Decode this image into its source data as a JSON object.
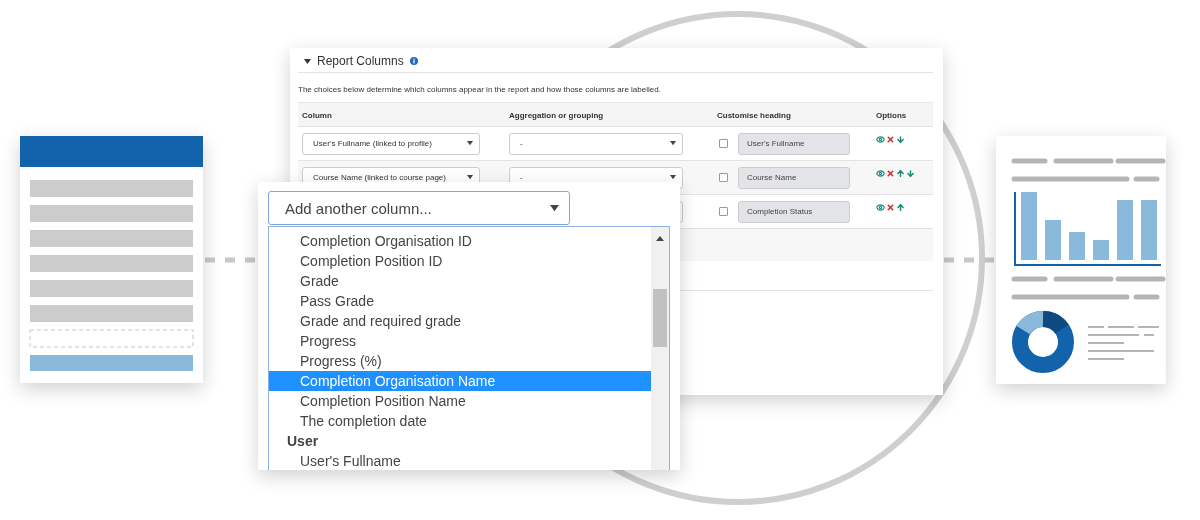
{
  "report": {
    "title": "Report Columns",
    "description": "The choices below determine which columns appear in the report and how those columns are labelled.",
    "columns": [
      "Column",
      "Aggregation or grouping",
      "Customise heading",
      "Options"
    ],
    "rows": [
      {
        "column": "User's Fullname (linked to profile)",
        "aggregation": "-",
        "custom": false,
        "heading": "User's Fullname",
        "actions": [
          {
            "kind": "show"
          },
          {
            "kind": "delete"
          },
          {
            "kind": "down"
          }
        ]
      },
      {
        "column": "Course Name (linked to course page)",
        "aggregation": "-",
        "custom": false,
        "heading": "Course Name",
        "actions": [
          {
            "kind": "show"
          },
          {
            "kind": "delete"
          },
          {
            "kind": "up"
          },
          {
            "kind": "down"
          }
        ]
      },
      {
        "custom": false,
        "heading": "Completion Status",
        "actions": [
          {
            "kind": "show"
          },
          {
            "kind": "delete"
          },
          {
            "kind": "up"
          }
        ]
      }
    ]
  },
  "add_column": {
    "value": "Add another column...",
    "options": [
      {
        "kind": "option",
        "label": "Completion Organisation ID",
        "selected": false
      },
      {
        "kind": "option",
        "label": "Completion Position ID",
        "selected": false
      },
      {
        "kind": "option",
        "label": "Grade",
        "selected": false
      },
      {
        "kind": "option",
        "label": "Pass Grade",
        "selected": false
      },
      {
        "kind": "option",
        "label": "Grade and required grade",
        "selected": false
      },
      {
        "kind": "option",
        "label": "Progress",
        "selected": false
      },
      {
        "kind": "option",
        "label": "Progress (%)",
        "selected": false
      },
      {
        "kind": "option",
        "label": "Completion Organisation Name",
        "selected": true
      },
      {
        "kind": "option",
        "label": "Completion Position Name",
        "selected": false
      },
      {
        "kind": "option",
        "label": "The completion date",
        "selected": false
      },
      {
        "kind": "group",
        "label": "User"
      },
      {
        "kind": "option",
        "label": "User's Fullname",
        "selected": false
      }
    ]
  }
}
